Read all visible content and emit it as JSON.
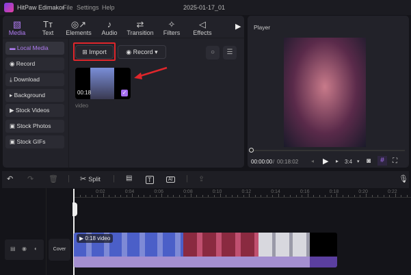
{
  "app": {
    "title": "HitPaw Edimakor",
    "menu": [
      "File",
      "Settings",
      "Help"
    ],
    "project": "2025-01-17_01"
  },
  "tabs": [
    {
      "label": "Media",
      "icon": "media-icon"
    },
    {
      "label": "Text",
      "icon": "text-icon"
    },
    {
      "label": "Elements",
      "icon": "elements-icon"
    },
    {
      "label": "Audio",
      "icon": "audio-icon"
    },
    {
      "label": "Transition",
      "icon": "transition-icon"
    },
    {
      "label": "Filters",
      "icon": "filters-icon"
    },
    {
      "label": "Effects",
      "icon": "effects-icon"
    }
  ],
  "sidebar": [
    "Local Media",
    "Record",
    "Download",
    "Background",
    "Stock Videos",
    "Stock Photos",
    "Stock GIFs"
  ],
  "media": {
    "import": "Import",
    "record": "Record",
    "clip_duration": "00:18",
    "clip_name": "video"
  },
  "player": {
    "title": "Player",
    "current": "00:00:00",
    "separator": "/",
    "total": "00:18:02",
    "ratio": "3:4"
  },
  "timeline": {
    "split": "Split",
    "ticks": [
      "0:02",
      "0:04",
      "0:06",
      "0:08",
      "0:10",
      "0:12",
      "0:14",
      "0:16",
      "0:18",
      "0:20",
      "0:22"
    ],
    "cover": "Cover",
    "clip_label": "0:18 video"
  },
  "colors": {
    "accent": "#b07cf2",
    "highlight": "#e0262b",
    "audio": "#a48fd0"
  }
}
